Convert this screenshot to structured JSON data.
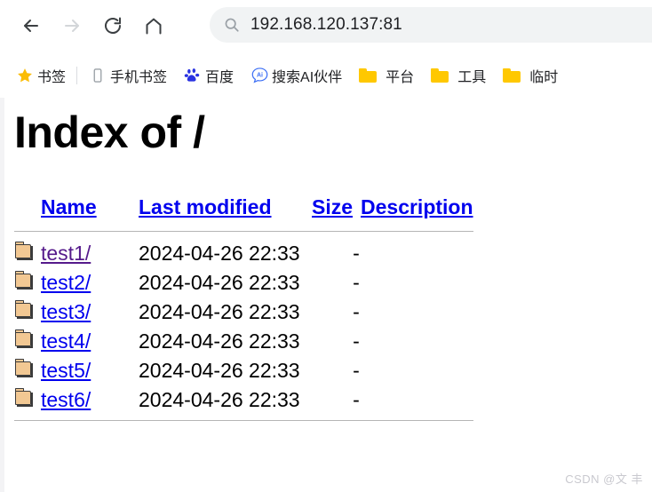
{
  "browser": {
    "toolbar": {
      "back_label": "Back",
      "forward_label": "Forward",
      "reload_label": "Reload",
      "home_label": "Home",
      "back_enabled": true,
      "forward_enabled": false
    },
    "omnibox": {
      "value": "192.168.120.137:81",
      "placeholder": "Search Google or type a URL",
      "icon": "search-icon",
      "background": "#f1f3f4"
    },
    "bookmarks": [
      {
        "label": "书签",
        "icon": "star-icon",
        "icon_color": "#fbbc04"
      },
      {
        "label": "手机书签",
        "icon": "phone-icon",
        "icon_color": "#9aa0a6"
      },
      {
        "label": "百度",
        "icon": "baidu-paw-icon",
        "icon_color": "#2932e1"
      },
      {
        "label": "搜索AI伙伴",
        "icon": "ai-badge-icon",
        "icon_color": "#3b6ef5"
      },
      {
        "label": "平台",
        "icon": "folder-icon",
        "icon_color": "#ffc800"
      },
      {
        "label": "工具",
        "icon": "folder-icon",
        "icon_color": "#ffc800"
      },
      {
        "label": "临时",
        "icon": "folder-icon",
        "icon_color": "#ffc800"
      }
    ]
  },
  "page": {
    "title": "Index of /",
    "columns": {
      "icon": "",
      "name": "Name",
      "last_modified": "Last modified",
      "size": "Size",
      "description": "Description"
    },
    "rows": [
      {
        "icon": "folder-icon",
        "name": "test1/",
        "last_modified": "2024-04-26 22:33",
        "size": "-",
        "description": "",
        "visited": true
      },
      {
        "icon": "folder-icon",
        "name": "test2/",
        "last_modified": "2024-04-26 22:33",
        "size": "-",
        "description": "",
        "visited": false
      },
      {
        "icon": "folder-icon",
        "name": "test3/",
        "last_modified": "2024-04-26 22:33",
        "size": "-",
        "description": "",
        "visited": false
      },
      {
        "icon": "folder-icon",
        "name": "test4/",
        "last_modified": "2024-04-26 22:33",
        "size": "-",
        "description": "",
        "visited": false
      },
      {
        "icon": "folder-icon",
        "name": "test5/",
        "last_modified": "2024-04-26 22:33",
        "size": "-",
        "description": "",
        "visited": false
      },
      {
        "icon": "folder-icon",
        "name": "test6/",
        "last_modified": "2024-04-26 22:33",
        "size": "-",
        "description": "",
        "visited": false
      }
    ],
    "link_color_unvisited": "#0000ee",
    "link_color_visited": "#551a8b"
  },
  "watermark": {
    "text": "CSDN @文 丰"
  }
}
